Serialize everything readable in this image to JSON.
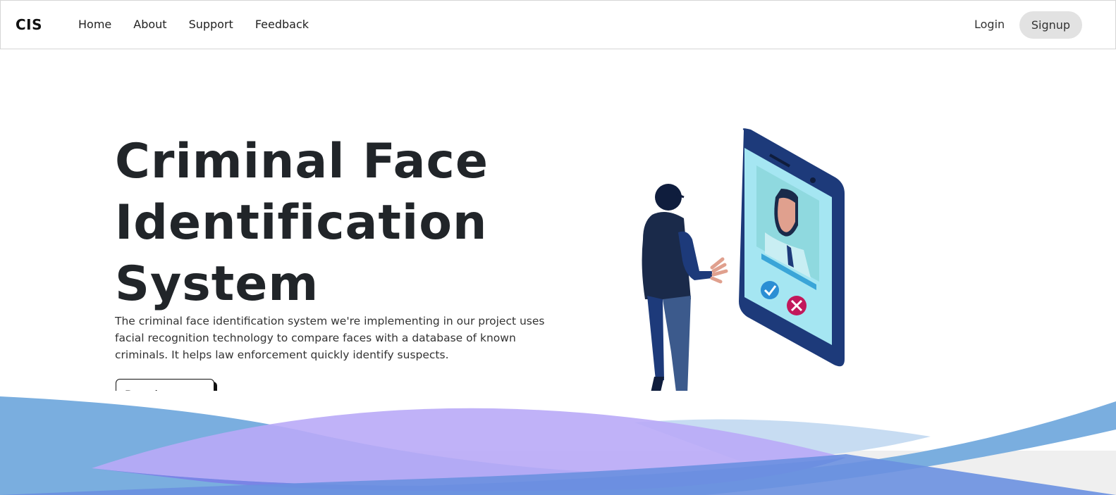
{
  "nav": {
    "brand": "CIS",
    "links": [
      "Home",
      "About",
      "Support",
      "Feedback"
    ],
    "login": "Login",
    "signup": "Signup"
  },
  "hero": {
    "title_line1": "Criminal Face",
    "title_line2": "Identification",
    "title_line3": "System",
    "description": "The criminal face identification system we're implementing in our project uses facial recognition technology to compare faces with a database of known criminals. It helps law enforcement quickly identify suspects.",
    "button": "Read more.."
  },
  "colors": {
    "wave_blue": "#7aaedf",
    "wave_purple": "#b9aaf7",
    "wave_light": "#c7dcf2",
    "phone_body": "#1d3a7a",
    "phone_screen": "#a5e6f2"
  }
}
